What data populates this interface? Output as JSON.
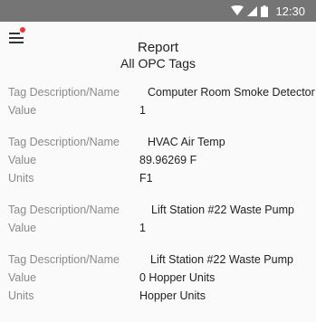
{
  "status_bar": {
    "time": "12:30",
    "icons": [
      "wifi-icon",
      "cell-signal-icon",
      "battery-icon"
    ]
  },
  "header": {
    "menu_icon": "menu-icon",
    "title": "Report",
    "subtitle": "All OPC Tags"
  },
  "labels": {
    "tag": "Tag Description/Name",
    "value": "Value",
    "units": "Units"
  },
  "records": [
    {
      "tag": "Computer Room Smoke Detector",
      "value": "1",
      "units": null
    },
    {
      "tag": "HVAC Air Temp",
      "value": "89.96269 F",
      "units": "F1"
    },
    {
      "tag": "Lift Station #22 Waste Pump",
      "value": "1",
      "units": null
    },
    {
      "tag": "Lift Station #22 Waste Pump",
      "value": "0 Hopper Units",
      "units": "Hopper Units"
    }
  ],
  "colors": {
    "status_bar_bg": "#757575",
    "page_bg": "#fafafa",
    "label_text": "#8a8a8a",
    "value_text": "#222222",
    "notification_dot": "#e53935"
  }
}
